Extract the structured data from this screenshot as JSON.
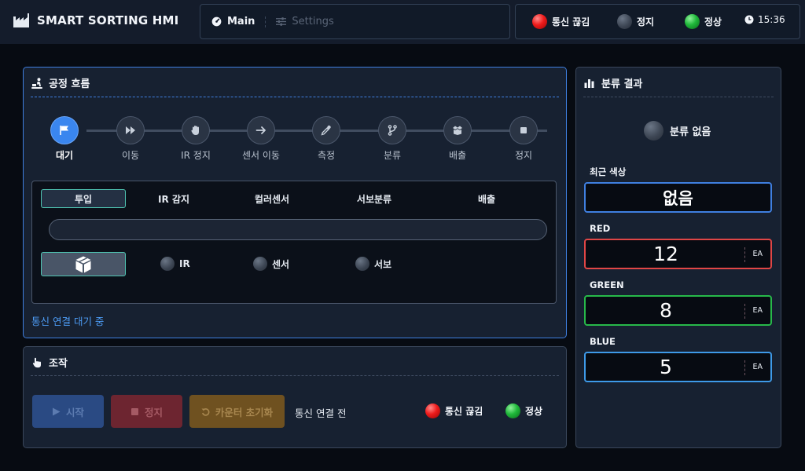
{
  "header": {
    "title": "SMART SORTING HMI",
    "nav": {
      "main": "Main",
      "settings": "Settings"
    },
    "status": {
      "comm": "통신 끊김",
      "stop": "정지",
      "normal": "정상",
      "time": "15:36"
    }
  },
  "process": {
    "title": "공정 흐름",
    "steps": [
      {
        "label": "대기",
        "icon": "flag-icon",
        "active": true
      },
      {
        "label": "이동",
        "icon": "fast-forward-icon",
        "active": false
      },
      {
        "label": "IR 정지",
        "icon": "hand-icon",
        "active": false
      },
      {
        "label": "센서 이동",
        "icon": "arrow-right-icon",
        "active": false
      },
      {
        "label": "측정",
        "icon": "eyedropper-icon",
        "active": false
      },
      {
        "label": "분류",
        "icon": "branch-icon",
        "active": false
      },
      {
        "label": "배출",
        "icon": "box-open-icon",
        "active": false
      },
      {
        "label": "정지",
        "icon": "stop-icon",
        "active": false
      }
    ],
    "stages": [
      "투입",
      "IR 감지",
      "컬러센서",
      "서보분류",
      "배출"
    ],
    "sensors": {
      "ir": "IR",
      "color": "센서",
      "servo": "서보"
    },
    "note": "통신 연결 대기 중"
  },
  "control": {
    "title": "조작",
    "start": "시작",
    "stop": "정지",
    "reset": "카운터 초기화",
    "conn_status": "통신 연결 전",
    "comm": "통신 끊김",
    "normal": "정상"
  },
  "result": {
    "title": "분류 결과",
    "status": "분류 없음",
    "recent_label": "최근 색상",
    "recent_value": "없음",
    "counters": [
      {
        "label": "RED",
        "value": "12",
        "unit": "EA",
        "color": "#e04646"
      },
      {
        "label": "GREEN",
        "value": "8",
        "unit": "EA",
        "color": "#27b94a"
      },
      {
        "label": "BLUE",
        "value": "5",
        "unit": "EA",
        "color": "#3e9ae8"
      }
    ]
  },
  "colors": {
    "accent": "#3a86ef",
    "teal": "#4fc4b2",
    "led_red": "#ee1b1b",
    "led_green": "#1fb83a",
    "led_off": "#3d4654"
  }
}
